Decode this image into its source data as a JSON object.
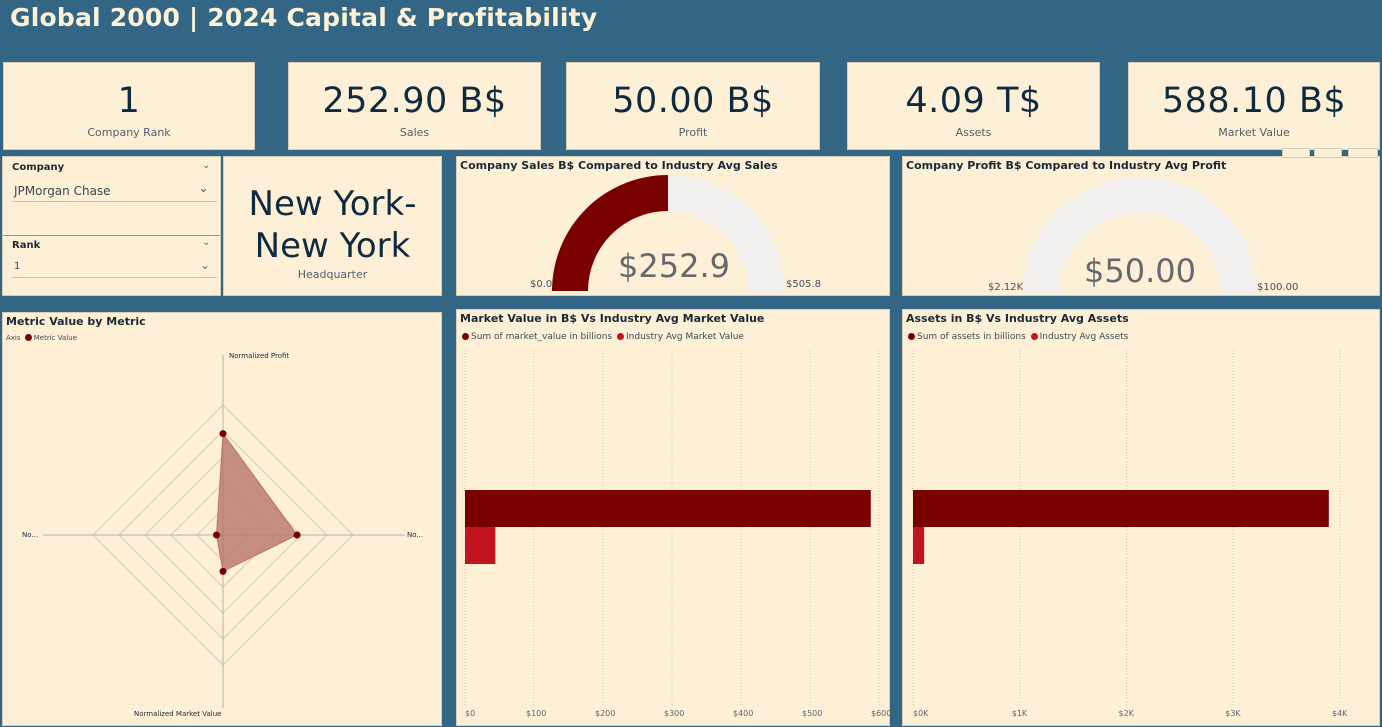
{
  "page_title": "Global 2000 | 2024 Capital & Profitability",
  "kpis": [
    {
      "value": "1",
      "label": "Company Rank"
    },
    {
      "value": "252.90 B$",
      "label": "Sales"
    },
    {
      "value": "50.00 B$",
      "label": "Profit"
    },
    {
      "value": "4.09 T$",
      "label": "Assets"
    },
    {
      "value": "588.10 B$",
      "label": "Market Value"
    }
  ],
  "slicers": {
    "company": {
      "header": "Company",
      "value": "JPMorgan Chase"
    },
    "rank": {
      "header": "Rank",
      "value": "1"
    }
  },
  "headquarter": {
    "line1": "New York-",
    "line2": "New York",
    "label": "Headquarter"
  },
  "gauge_sales": {
    "title": "Company Sales B$ Compared to Industry Avg Sales",
    "value_label": "$252.9",
    "min_label": "$0.0",
    "max_label": "$505.8",
    "value": 252.9,
    "min": 0,
    "max": 505.8,
    "fill_color": "#7a0000",
    "track_color": "#f1f0ef"
  },
  "gauge_profit": {
    "title": "Company Profit B$ Compared to Industry Avg Profit",
    "value_label": "$50.00",
    "min_label": "$2.12K",
    "max_label": "$100.00",
    "value": 0,
    "min": 0,
    "max": 100,
    "fill_color": "#7a0000",
    "track_color": "#f1f0ef"
  },
  "radar": {
    "title": "Metric Value by Metric",
    "legend_axis": "Axis",
    "legend_series": "Metric Value",
    "axis_top": "Normalized Profit",
    "axis_bottom": "Normalized Market Value",
    "axis_left": "No...",
    "axis_right": "No...",
    "color": "#7a0000",
    "fill": "#b8756a"
  },
  "chart_data": [
    {
      "type": "radar",
      "title": "Metric Value by Metric",
      "categories": [
        "Normalized Profit",
        "No...",
        "Normalized Market Value",
        "No..."
      ],
      "series": [
        {
          "name": "Metric Value",
          "values": [
            0.78,
            0.57,
            0.28,
            0.05
          ]
        }
      ],
      "range": [
        0,
        1
      ]
    },
    {
      "type": "bar",
      "title": "Market Value in B$ Vs Industry Avg Market Value",
      "orientation": "horizontal",
      "series": [
        {
          "name": "Sum of market_value in billions",
          "values": [
            588.1
          ],
          "color": "#7a0000"
        },
        {
          "name": "Industry Avg Market Value",
          "values": [
            44
          ],
          "color": "#c0141e"
        }
      ],
      "xlim": [
        0,
        600
      ],
      "xticks": [
        "$0",
        "$100",
        "$200",
        "$300",
        "$400",
        "$500",
        "$600"
      ],
      "grid": true,
      "legend": "top-left"
    },
    {
      "type": "bar",
      "title": "Assets in B$ Vs Industry Avg Assets",
      "orientation": "horizontal",
      "series": [
        {
          "name": "Sum of assets in billions",
          "values": [
            4090
          ],
          "color": "#7a0000"
        },
        {
          "name": "Industry Avg Assets",
          "values": [
            110
          ],
          "color": "#c0141e"
        }
      ],
      "xlim": [
        0,
        4200
      ],
      "xticks": [
        "$0K",
        "$1K",
        "$2K",
        "$3K",
        "$4K"
      ],
      "grid": true,
      "legend": "top-left"
    }
  ]
}
